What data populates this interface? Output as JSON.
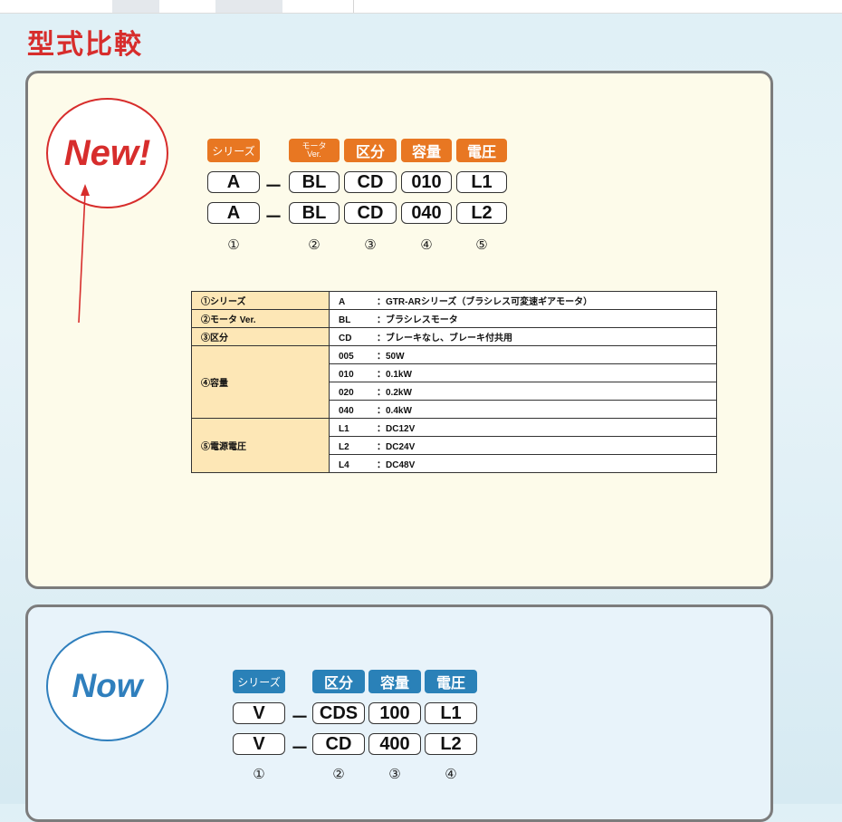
{
  "page": {
    "title": "型式比較"
  },
  "new_panel": {
    "badge": "New!",
    "headers": [
      "シリーズ",
      "モータ",
      "Ver.",
      "区分",
      "容量",
      "電圧"
    ],
    "rows": [
      [
        "A",
        "－",
        "BL",
        "CD",
        "010",
        "L1"
      ],
      [
        "A",
        "－",
        "BL",
        "CD",
        "040",
        "L2"
      ]
    ],
    "numbers": [
      "①",
      "②",
      "③",
      "④",
      "⑤"
    ],
    "table": {
      "series": {
        "label": "①シリーズ",
        "code": "A",
        "desc": "：GTR-ARシリーズ（ブラシレス可変速ギアモータ）"
      },
      "motor": {
        "label": "②モータ Ver.",
        "code": "BL",
        "desc": "：ブラシレスモータ"
      },
      "division": {
        "label": "③区分",
        "code": "CD",
        "desc": "：ブレーキなし、ブレーキ付共用"
      },
      "capacity": {
        "label": "④容量",
        "items": [
          {
            "code": "005",
            "desc": "：50W"
          },
          {
            "code": "010",
            "desc": "：0.1kW"
          },
          {
            "code": "020",
            "desc": "：0.2kW"
          },
          {
            "code": "040",
            "desc": "：0.4kW"
          }
        ]
      },
      "voltage": {
        "label": "⑤電源電圧",
        "items": [
          {
            "code": "L1",
            "desc": "：DC12V"
          },
          {
            "code": "L2",
            "desc": "：DC24V"
          },
          {
            "code": "L4",
            "desc": "：DC48V"
          }
        ]
      }
    }
  },
  "now_panel": {
    "badge": "Now",
    "headers": [
      "シリーズ",
      "区分",
      "容量",
      "電圧"
    ],
    "rows": [
      [
        "V",
        "－",
        "CDS",
        "100",
        "L1"
      ],
      [
        "V",
        "－",
        "CD",
        "400",
        "L2"
      ]
    ],
    "numbers": [
      "①",
      "②",
      "③",
      "④"
    ]
  },
  "colors": {
    "accent_red": "#d72d2c",
    "orange": "#e87722",
    "blue": "#2a81b8"
  }
}
